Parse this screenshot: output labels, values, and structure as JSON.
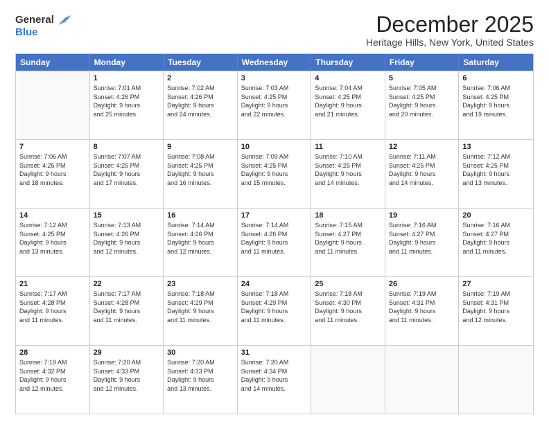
{
  "logo": {
    "general": "General",
    "blue": "Blue"
  },
  "title": "December 2025",
  "subtitle": "Heritage Hills, New York, United States",
  "days_of_week": [
    "Sunday",
    "Monday",
    "Tuesday",
    "Wednesday",
    "Thursday",
    "Friday",
    "Saturday"
  ],
  "weeks": [
    [
      {
        "day": null,
        "info": null
      },
      {
        "day": "1",
        "info": "Sunrise: 7:01 AM\nSunset: 4:26 PM\nDaylight: 9 hours\nand 25 minutes."
      },
      {
        "day": "2",
        "info": "Sunrise: 7:02 AM\nSunset: 4:26 PM\nDaylight: 9 hours\nand 24 minutes."
      },
      {
        "day": "3",
        "info": "Sunrise: 7:03 AM\nSunset: 4:25 PM\nDaylight: 9 hours\nand 22 minutes."
      },
      {
        "day": "4",
        "info": "Sunrise: 7:04 AM\nSunset: 4:25 PM\nDaylight: 9 hours\nand 21 minutes."
      },
      {
        "day": "5",
        "info": "Sunrise: 7:05 AM\nSunset: 4:25 PM\nDaylight: 9 hours\nand 20 minutes."
      },
      {
        "day": "6",
        "info": "Sunrise: 7:06 AM\nSunset: 4:25 PM\nDaylight: 9 hours\nand 19 minutes."
      }
    ],
    [
      {
        "day": "7",
        "info": "Sunrise: 7:06 AM\nSunset: 4:25 PM\nDaylight: 9 hours\nand 18 minutes."
      },
      {
        "day": "8",
        "info": "Sunrise: 7:07 AM\nSunset: 4:25 PM\nDaylight: 9 hours\nand 17 minutes."
      },
      {
        "day": "9",
        "info": "Sunrise: 7:08 AM\nSunset: 4:25 PM\nDaylight: 9 hours\nand 16 minutes."
      },
      {
        "day": "10",
        "info": "Sunrise: 7:09 AM\nSunset: 4:25 PM\nDaylight: 9 hours\nand 15 minutes."
      },
      {
        "day": "11",
        "info": "Sunrise: 7:10 AM\nSunset: 4:25 PM\nDaylight: 9 hours\nand 14 minutes."
      },
      {
        "day": "12",
        "info": "Sunrise: 7:11 AM\nSunset: 4:25 PM\nDaylight: 9 hours\nand 14 minutes."
      },
      {
        "day": "13",
        "info": "Sunrise: 7:12 AM\nSunset: 4:25 PM\nDaylight: 9 hours\nand 13 minutes."
      }
    ],
    [
      {
        "day": "14",
        "info": "Sunrise: 7:12 AM\nSunset: 4:25 PM\nDaylight: 9 hours\nand 13 minutes."
      },
      {
        "day": "15",
        "info": "Sunrise: 7:13 AM\nSunset: 4:26 PM\nDaylight: 9 hours\nand 12 minutes."
      },
      {
        "day": "16",
        "info": "Sunrise: 7:14 AM\nSunset: 4:26 PM\nDaylight: 9 hours\nand 12 minutes."
      },
      {
        "day": "17",
        "info": "Sunrise: 7:14 AM\nSunset: 4:26 PM\nDaylight: 9 hours\nand 11 minutes."
      },
      {
        "day": "18",
        "info": "Sunrise: 7:15 AM\nSunset: 4:27 PM\nDaylight: 9 hours\nand 11 minutes."
      },
      {
        "day": "19",
        "info": "Sunrise: 7:16 AM\nSunset: 4:27 PM\nDaylight: 9 hours\nand 11 minutes."
      },
      {
        "day": "20",
        "info": "Sunrise: 7:16 AM\nSunset: 4:27 PM\nDaylight: 9 hours\nand 11 minutes."
      }
    ],
    [
      {
        "day": "21",
        "info": "Sunrise: 7:17 AM\nSunset: 4:28 PM\nDaylight: 9 hours\nand 11 minutes."
      },
      {
        "day": "22",
        "info": "Sunrise: 7:17 AM\nSunset: 4:28 PM\nDaylight: 9 hours\nand 11 minutes."
      },
      {
        "day": "23",
        "info": "Sunrise: 7:18 AM\nSunset: 4:29 PM\nDaylight: 9 hours\nand 11 minutes."
      },
      {
        "day": "24",
        "info": "Sunrise: 7:18 AM\nSunset: 4:29 PM\nDaylight: 9 hours\nand 11 minutes."
      },
      {
        "day": "25",
        "info": "Sunrise: 7:18 AM\nSunset: 4:30 PM\nDaylight: 9 hours\nand 11 minutes."
      },
      {
        "day": "26",
        "info": "Sunrise: 7:19 AM\nSunset: 4:31 PM\nDaylight: 9 hours\nand 11 minutes."
      },
      {
        "day": "27",
        "info": "Sunrise: 7:19 AM\nSunset: 4:31 PM\nDaylight: 9 hours\nand 12 minutes."
      }
    ],
    [
      {
        "day": "28",
        "info": "Sunrise: 7:19 AM\nSunset: 4:32 PM\nDaylight: 9 hours\nand 12 minutes."
      },
      {
        "day": "29",
        "info": "Sunrise: 7:20 AM\nSunset: 4:33 PM\nDaylight: 9 hours\nand 12 minutes."
      },
      {
        "day": "30",
        "info": "Sunrise: 7:20 AM\nSunset: 4:33 PM\nDaylight: 9 hours\nand 13 minutes."
      },
      {
        "day": "31",
        "info": "Sunrise: 7:20 AM\nSunset: 4:34 PM\nDaylight: 9 hours\nand 14 minutes."
      },
      {
        "day": null,
        "info": null
      },
      {
        "day": null,
        "info": null
      },
      {
        "day": null,
        "info": null
      }
    ]
  ]
}
